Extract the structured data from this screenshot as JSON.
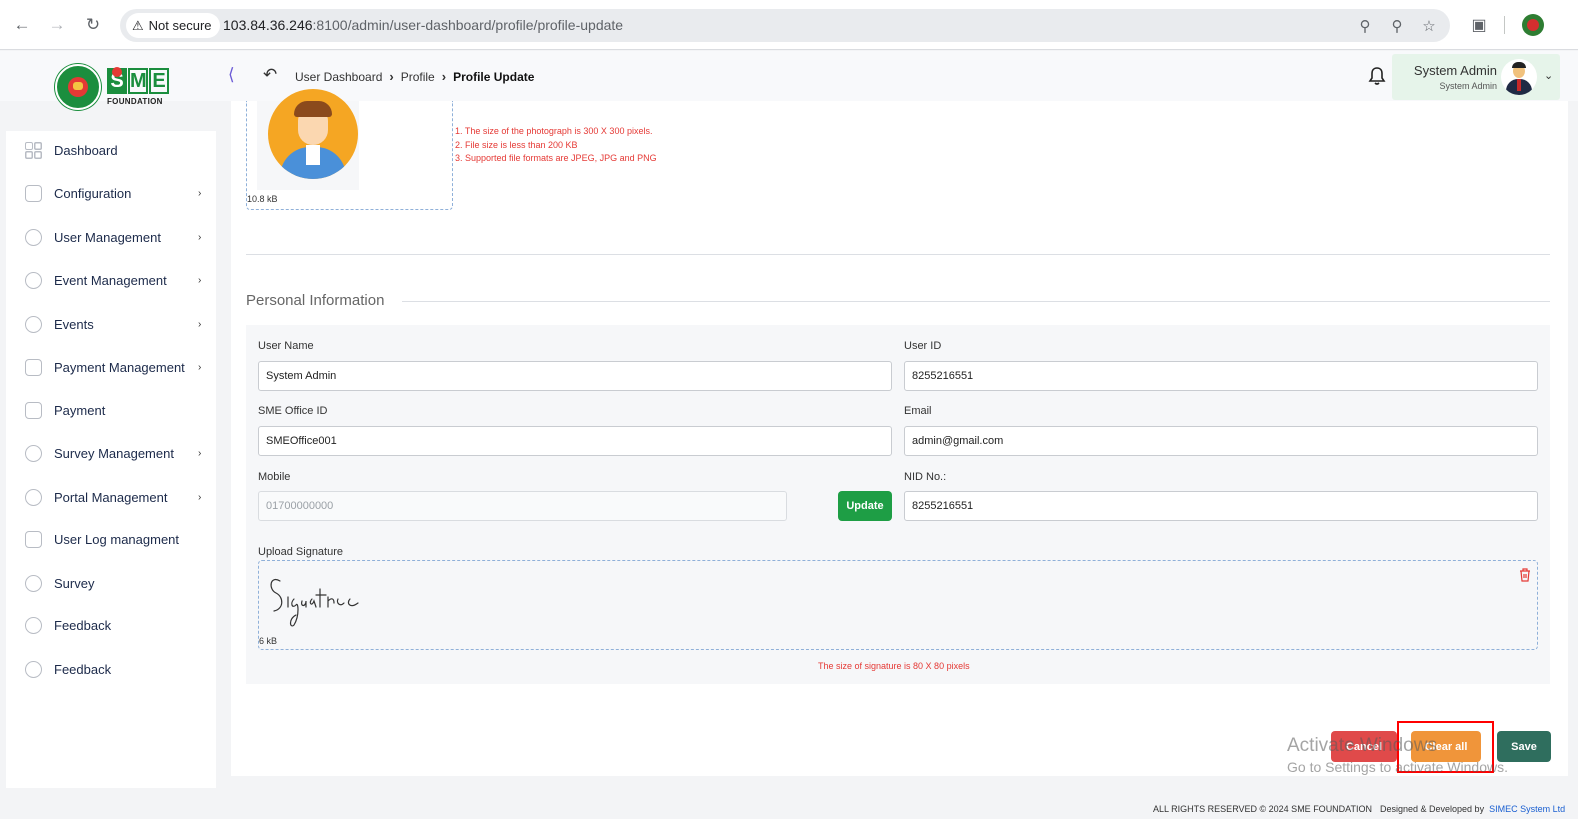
{
  "browser": {
    "security_label": "Not secure",
    "url_host": "103.84.36.246",
    "url_rest": ":8100/admin/user-dashboard/profile/profile-update"
  },
  "logo": {
    "letters": [
      "S",
      "M",
      "E"
    ],
    "subtitle": "FOUNDATION"
  },
  "breadcrumb": {
    "items": [
      "User Dashboard",
      "Profile"
    ],
    "current": "Profile Update"
  },
  "user": {
    "name": "System Admin",
    "role": "System Admin"
  },
  "sidebar": {
    "items": [
      {
        "label": "Dashboard",
        "icon": "grid-icon",
        "has_children": false
      },
      {
        "label": "Configuration",
        "icon": "config-icon",
        "has_children": true
      },
      {
        "label": "User Management",
        "icon": "user-management-icon",
        "has_children": true
      },
      {
        "label": "Event Management",
        "icon": "lock-icon",
        "has_children": true
      },
      {
        "label": "Events",
        "icon": "lock-icon",
        "has_children": true
      },
      {
        "label": "Payment Management",
        "icon": "payment-icon",
        "has_children": true
      },
      {
        "label": "Payment",
        "icon": "payment-icon",
        "has_children": false
      },
      {
        "label": "Survey Management",
        "icon": "survey-icon",
        "has_children": true
      },
      {
        "label": "Portal Management",
        "icon": "lock-icon",
        "has_children": true
      },
      {
        "label": "User Log managment",
        "icon": "payment-icon",
        "has_children": false
      },
      {
        "label": "Survey",
        "icon": "survey-icon",
        "has_children": false
      },
      {
        "label": "Feedback",
        "icon": "feedback-icon",
        "has_children": false
      },
      {
        "label": "Feedback",
        "icon": "feedback-icon",
        "has_children": false
      }
    ]
  },
  "photo": {
    "size": "10.8 kB",
    "rules": [
      "1. The size of the photograph is 300 X 300 pixels.",
      "2. File size is less than 200 KB",
      "3. Supported file formats are JPEG, JPG and PNG"
    ]
  },
  "section": {
    "title": "Personal Information"
  },
  "form": {
    "user_name_label": "User Name",
    "user_name_value": "System Admin",
    "user_id_label": "User ID",
    "user_id_value": "8255216551",
    "office_id_label": "SME Office ID",
    "office_id_value": "SMEOffice001",
    "email_label": "Email",
    "email_value": "admin@gmail.com",
    "mobile_label": "Mobile",
    "mobile_placeholder": "01700000000",
    "update_label": "Update",
    "nid_label": "NID No.:",
    "nid_value": "8255216551",
    "signature_label": "Upload Signature",
    "signature_size": "6 kB",
    "signature_note": "The size of signature is 80 X 80 pixels"
  },
  "actions": {
    "cancel": "Cancel",
    "clear_all": "Clear all",
    "save": "Save"
  },
  "watermark": {
    "line1": "Activate Windows",
    "line2": "Go to Settings to activate Windows."
  },
  "footer": {
    "rights": "ALL RIGHTS RESERVED © 2024 SME FOUNDATION",
    "designed_by": "Designed & Developed by",
    "developer": "SIMEC System Ltd"
  },
  "colors": {
    "brand_green": "#1b8e3e",
    "update_green": "#1e9e45",
    "cancel_red": "#e04a4a",
    "clear_orange": "#f0953a",
    "save_teal": "#2f6e5e",
    "warning_red": "#e53935"
  }
}
